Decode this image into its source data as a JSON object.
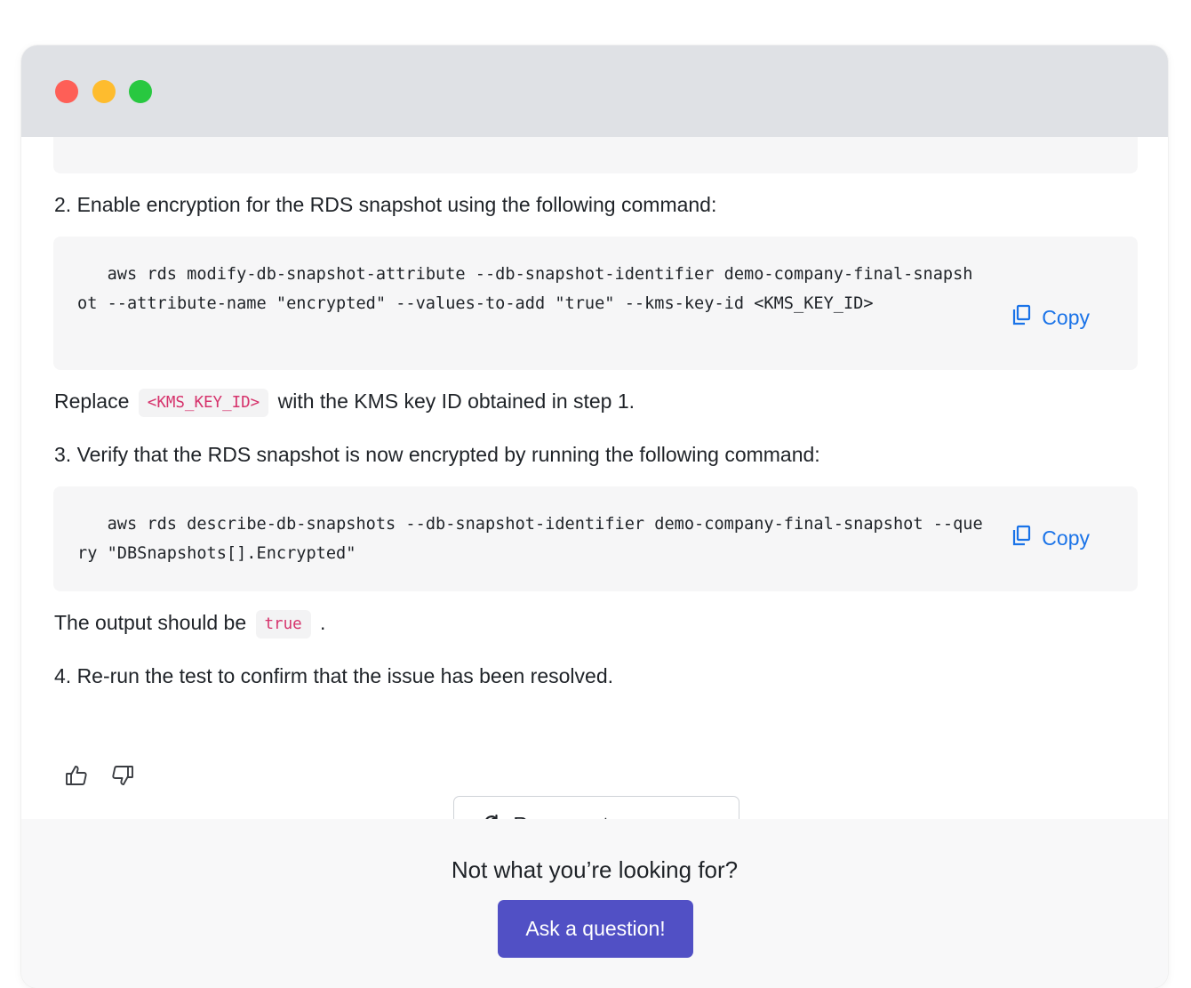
{
  "steps": {
    "step2": "2. Enable encryption for the RDS snapshot using the following command:",
    "code1": "   aws rds modify-db-snapshot-attribute --db-snapshot-identifier demo-company-final-snapshot --attribute-name \"encrypted\" --values-to-add \"true\" --kms-key-id <KMS_KEY_ID>",
    "replace_before": "Replace",
    "replace_code": "<KMS_KEY_ID>",
    "replace_after": "with the KMS key ID obtained in step 1.",
    "step3": "3. Verify that the RDS snapshot is now encrypted by running the following command:",
    "code2": "   aws rds describe-db-snapshots --db-snapshot-identifier demo-company-final-snapshot --query \"DBSnapshots[].Encrypted\"",
    "output_before": "The output should be",
    "output_code": "true",
    "output_after": ".",
    "step4": "4. Re-run the test to confirm that the issue has been resolved."
  },
  "copy_label": "Copy",
  "regenerate_label": "Regenerate response",
  "footer": {
    "prompt": "Not what you’re looking for?",
    "ask_label": "Ask a question!"
  },
  "icons": {
    "copy": "copy-icon",
    "thumbs_up": "thumbs-up-icon",
    "thumbs_down": "thumbs-down-icon",
    "regenerate": "refresh-icon"
  },
  "colors": {
    "window_chrome": "#dfe1e5",
    "close": "#fe5f57",
    "minimize": "#febc2e",
    "maximize": "#28c840",
    "link_blue": "#1a73e8",
    "inline_code": "#d6336c",
    "primary_button": "#5150c5"
  }
}
